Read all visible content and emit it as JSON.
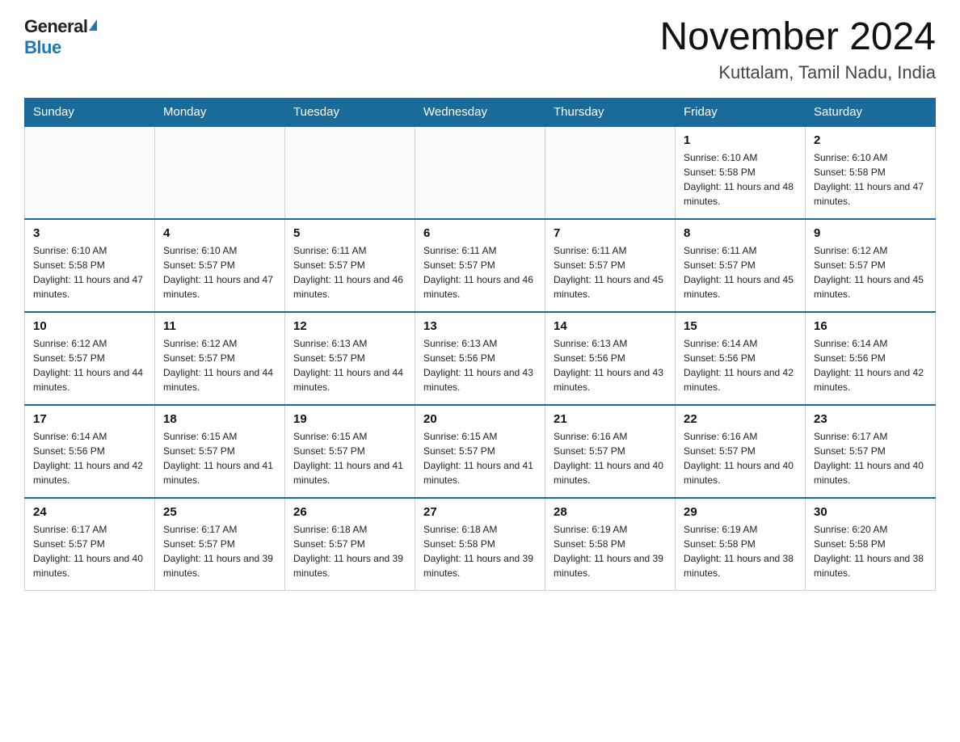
{
  "header": {
    "logo_general": "General",
    "logo_blue": "Blue",
    "title": "November 2024",
    "location": "Kuttalam, Tamil Nadu, India"
  },
  "weekdays": [
    "Sunday",
    "Monday",
    "Tuesday",
    "Wednesday",
    "Thursday",
    "Friday",
    "Saturday"
  ],
  "weeks": [
    [
      {
        "day": "",
        "info": ""
      },
      {
        "day": "",
        "info": ""
      },
      {
        "day": "",
        "info": ""
      },
      {
        "day": "",
        "info": ""
      },
      {
        "day": "",
        "info": ""
      },
      {
        "day": "1",
        "info": "Sunrise: 6:10 AM\nSunset: 5:58 PM\nDaylight: 11 hours and 48 minutes."
      },
      {
        "day": "2",
        "info": "Sunrise: 6:10 AM\nSunset: 5:58 PM\nDaylight: 11 hours and 47 minutes."
      }
    ],
    [
      {
        "day": "3",
        "info": "Sunrise: 6:10 AM\nSunset: 5:58 PM\nDaylight: 11 hours and 47 minutes."
      },
      {
        "day": "4",
        "info": "Sunrise: 6:10 AM\nSunset: 5:57 PM\nDaylight: 11 hours and 47 minutes."
      },
      {
        "day": "5",
        "info": "Sunrise: 6:11 AM\nSunset: 5:57 PM\nDaylight: 11 hours and 46 minutes."
      },
      {
        "day": "6",
        "info": "Sunrise: 6:11 AM\nSunset: 5:57 PM\nDaylight: 11 hours and 46 minutes."
      },
      {
        "day": "7",
        "info": "Sunrise: 6:11 AM\nSunset: 5:57 PM\nDaylight: 11 hours and 45 minutes."
      },
      {
        "day": "8",
        "info": "Sunrise: 6:11 AM\nSunset: 5:57 PM\nDaylight: 11 hours and 45 minutes."
      },
      {
        "day": "9",
        "info": "Sunrise: 6:12 AM\nSunset: 5:57 PM\nDaylight: 11 hours and 45 minutes."
      }
    ],
    [
      {
        "day": "10",
        "info": "Sunrise: 6:12 AM\nSunset: 5:57 PM\nDaylight: 11 hours and 44 minutes."
      },
      {
        "day": "11",
        "info": "Sunrise: 6:12 AM\nSunset: 5:57 PM\nDaylight: 11 hours and 44 minutes."
      },
      {
        "day": "12",
        "info": "Sunrise: 6:13 AM\nSunset: 5:57 PM\nDaylight: 11 hours and 44 minutes."
      },
      {
        "day": "13",
        "info": "Sunrise: 6:13 AM\nSunset: 5:56 PM\nDaylight: 11 hours and 43 minutes."
      },
      {
        "day": "14",
        "info": "Sunrise: 6:13 AM\nSunset: 5:56 PM\nDaylight: 11 hours and 43 minutes."
      },
      {
        "day": "15",
        "info": "Sunrise: 6:14 AM\nSunset: 5:56 PM\nDaylight: 11 hours and 42 minutes."
      },
      {
        "day": "16",
        "info": "Sunrise: 6:14 AM\nSunset: 5:56 PM\nDaylight: 11 hours and 42 minutes."
      }
    ],
    [
      {
        "day": "17",
        "info": "Sunrise: 6:14 AM\nSunset: 5:56 PM\nDaylight: 11 hours and 42 minutes."
      },
      {
        "day": "18",
        "info": "Sunrise: 6:15 AM\nSunset: 5:57 PM\nDaylight: 11 hours and 41 minutes."
      },
      {
        "day": "19",
        "info": "Sunrise: 6:15 AM\nSunset: 5:57 PM\nDaylight: 11 hours and 41 minutes."
      },
      {
        "day": "20",
        "info": "Sunrise: 6:15 AM\nSunset: 5:57 PM\nDaylight: 11 hours and 41 minutes."
      },
      {
        "day": "21",
        "info": "Sunrise: 6:16 AM\nSunset: 5:57 PM\nDaylight: 11 hours and 40 minutes."
      },
      {
        "day": "22",
        "info": "Sunrise: 6:16 AM\nSunset: 5:57 PM\nDaylight: 11 hours and 40 minutes."
      },
      {
        "day": "23",
        "info": "Sunrise: 6:17 AM\nSunset: 5:57 PM\nDaylight: 11 hours and 40 minutes."
      }
    ],
    [
      {
        "day": "24",
        "info": "Sunrise: 6:17 AM\nSunset: 5:57 PM\nDaylight: 11 hours and 40 minutes."
      },
      {
        "day": "25",
        "info": "Sunrise: 6:17 AM\nSunset: 5:57 PM\nDaylight: 11 hours and 39 minutes."
      },
      {
        "day": "26",
        "info": "Sunrise: 6:18 AM\nSunset: 5:57 PM\nDaylight: 11 hours and 39 minutes."
      },
      {
        "day": "27",
        "info": "Sunrise: 6:18 AM\nSunset: 5:58 PM\nDaylight: 11 hours and 39 minutes."
      },
      {
        "day": "28",
        "info": "Sunrise: 6:19 AM\nSunset: 5:58 PM\nDaylight: 11 hours and 39 minutes."
      },
      {
        "day": "29",
        "info": "Sunrise: 6:19 AM\nSunset: 5:58 PM\nDaylight: 11 hours and 38 minutes."
      },
      {
        "day": "30",
        "info": "Sunrise: 6:20 AM\nSunset: 5:58 PM\nDaylight: 11 hours and 38 minutes."
      }
    ]
  ]
}
